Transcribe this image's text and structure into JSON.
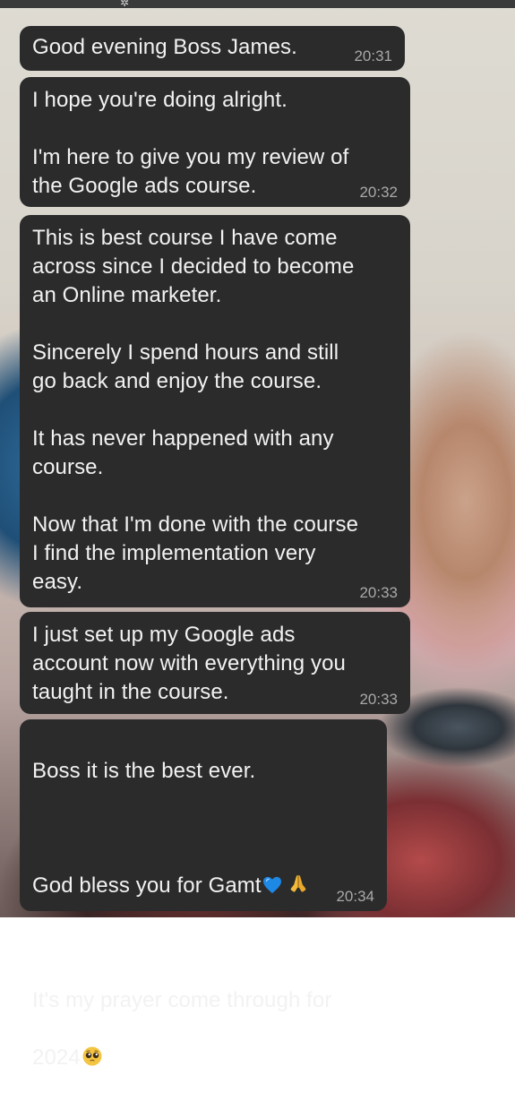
{
  "status_bar": {
    "icon": "signal-icon"
  },
  "messages": [
    {
      "text": "Good evening Boss James.",
      "time": "20:31"
    },
    {
      "text": "I hope you're doing alright.\n\nI'm here to give you my review of\nthe Google ads course.",
      "time": "20:32"
    },
    {
      "text": "This is best course I have come\nacross since I decided to become\nan Online marketer.\n\nSincerely I spend hours and still\ngo back and enjoy the course.\n\nIt has never happened with any\ncourse.\n\nNow that I'm done with the course\nI find the implementation very\neasy.",
      "time": "20:33"
    },
    {
      "text": "I just set up my Google ads\naccount now with everything you\ntaught in the course.",
      "time": "20:33"
    },
    {
      "line1": "Boss it is the best ever.",
      "line2": "God bless you for Gamt",
      "line3": "It's my prayer come through for",
      "line4": "2024",
      "emojis": [
        "blue-heart-icon",
        "folded-hands-icon",
        "pleading-face-icon"
      ],
      "time": "20:34"
    }
  ],
  "colors": {
    "bubble": "#2b2b2c",
    "text": "#f2f2f2",
    "timestamp": "#a9a9a9",
    "heart": "#1e88e5",
    "hands": "#f2b93b"
  }
}
